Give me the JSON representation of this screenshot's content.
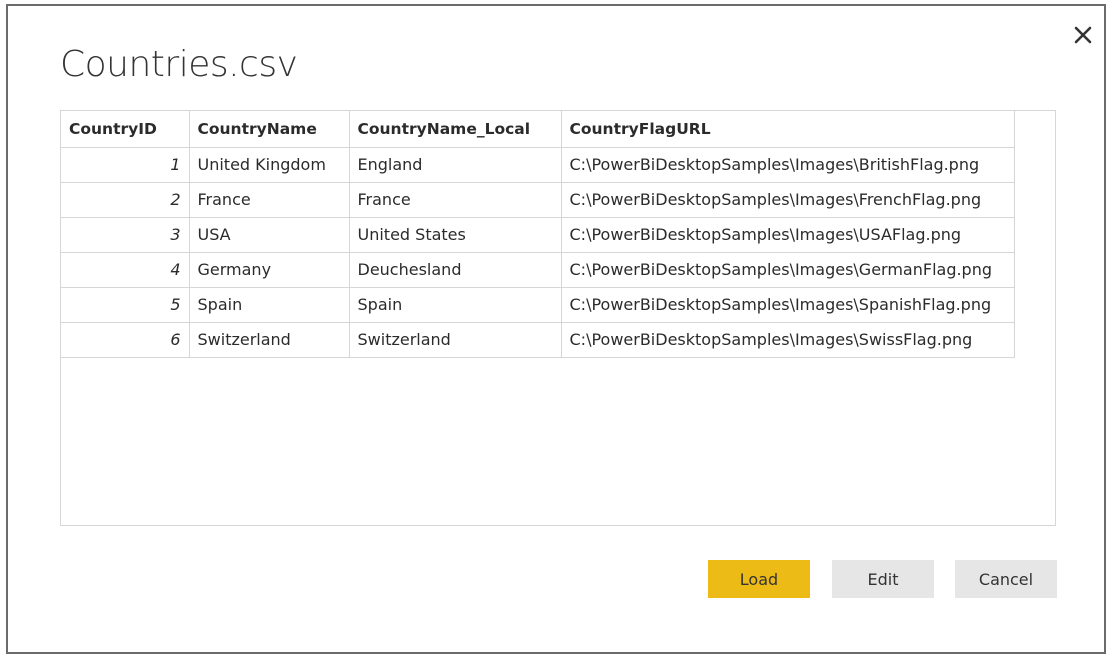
{
  "dialog": {
    "title": "Countries.csv",
    "close_icon": "close-icon"
  },
  "table": {
    "headers": [
      "CountryID",
      "CountryName",
      "CountryName_Local",
      "CountryFlagURL"
    ],
    "rows": [
      [
        "1",
        "United Kingdom",
        "England",
        "C:\\PowerBiDesktopSamples\\Images\\BritishFlag.png"
      ],
      [
        "2",
        "France",
        "France",
        "C:\\PowerBiDesktopSamples\\Images\\FrenchFlag.png"
      ],
      [
        "3",
        "USA",
        "United States",
        "C:\\PowerBiDesktopSamples\\Images\\USAFlag.png"
      ],
      [
        "4",
        "Germany",
        "Deuchesland",
        "C:\\PowerBiDesktopSamples\\Images\\GermanFlag.png"
      ],
      [
        "5",
        "Spain",
        "Spain",
        "C:\\PowerBiDesktopSamples\\Images\\SpanishFlag.png"
      ],
      [
        "6",
        "Switzerland",
        "Switzerland",
        "C:\\PowerBiDesktopSamples\\Images\\SwissFlag.png"
      ]
    ]
  },
  "buttons": {
    "load_label": "Load",
    "edit_label": "Edit",
    "cancel_label": "Cancel"
  },
  "colors": {
    "load_button": "#ecbb16",
    "secondary_button": "#e6e6e6",
    "grid_border": "#d6d6d6",
    "dialog_border": "#6b6b6b"
  }
}
